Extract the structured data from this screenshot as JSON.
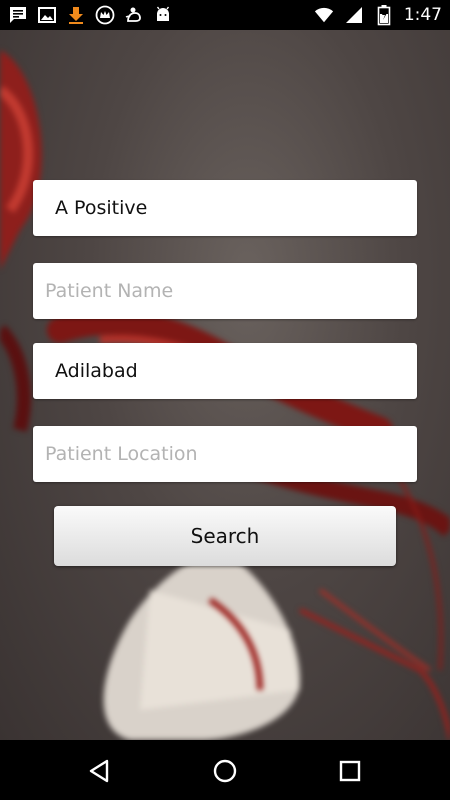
{
  "status_bar": {
    "time": "1:47",
    "left_icons": [
      "message-icon",
      "image-icon",
      "download-icon",
      "crown-icon",
      "uc-browser-icon",
      "android-icon"
    ],
    "right_icons": [
      "wifi-icon",
      "signal-icon",
      "battery-icon"
    ]
  },
  "form": {
    "blood_group_value": "A Positive",
    "patient_name_placeholder": "Patient Name",
    "city_value": "Adilabad",
    "patient_location_placeholder": "Patient Location",
    "search_label": "Search"
  },
  "nav_bar": {
    "buttons": [
      "back-icon",
      "home-icon",
      "recents-icon"
    ]
  },
  "colors": {
    "background": "#4e4644",
    "blood_red": "#a01818",
    "field": "#ffffff",
    "placeholder": "#b3b3b3"
  }
}
